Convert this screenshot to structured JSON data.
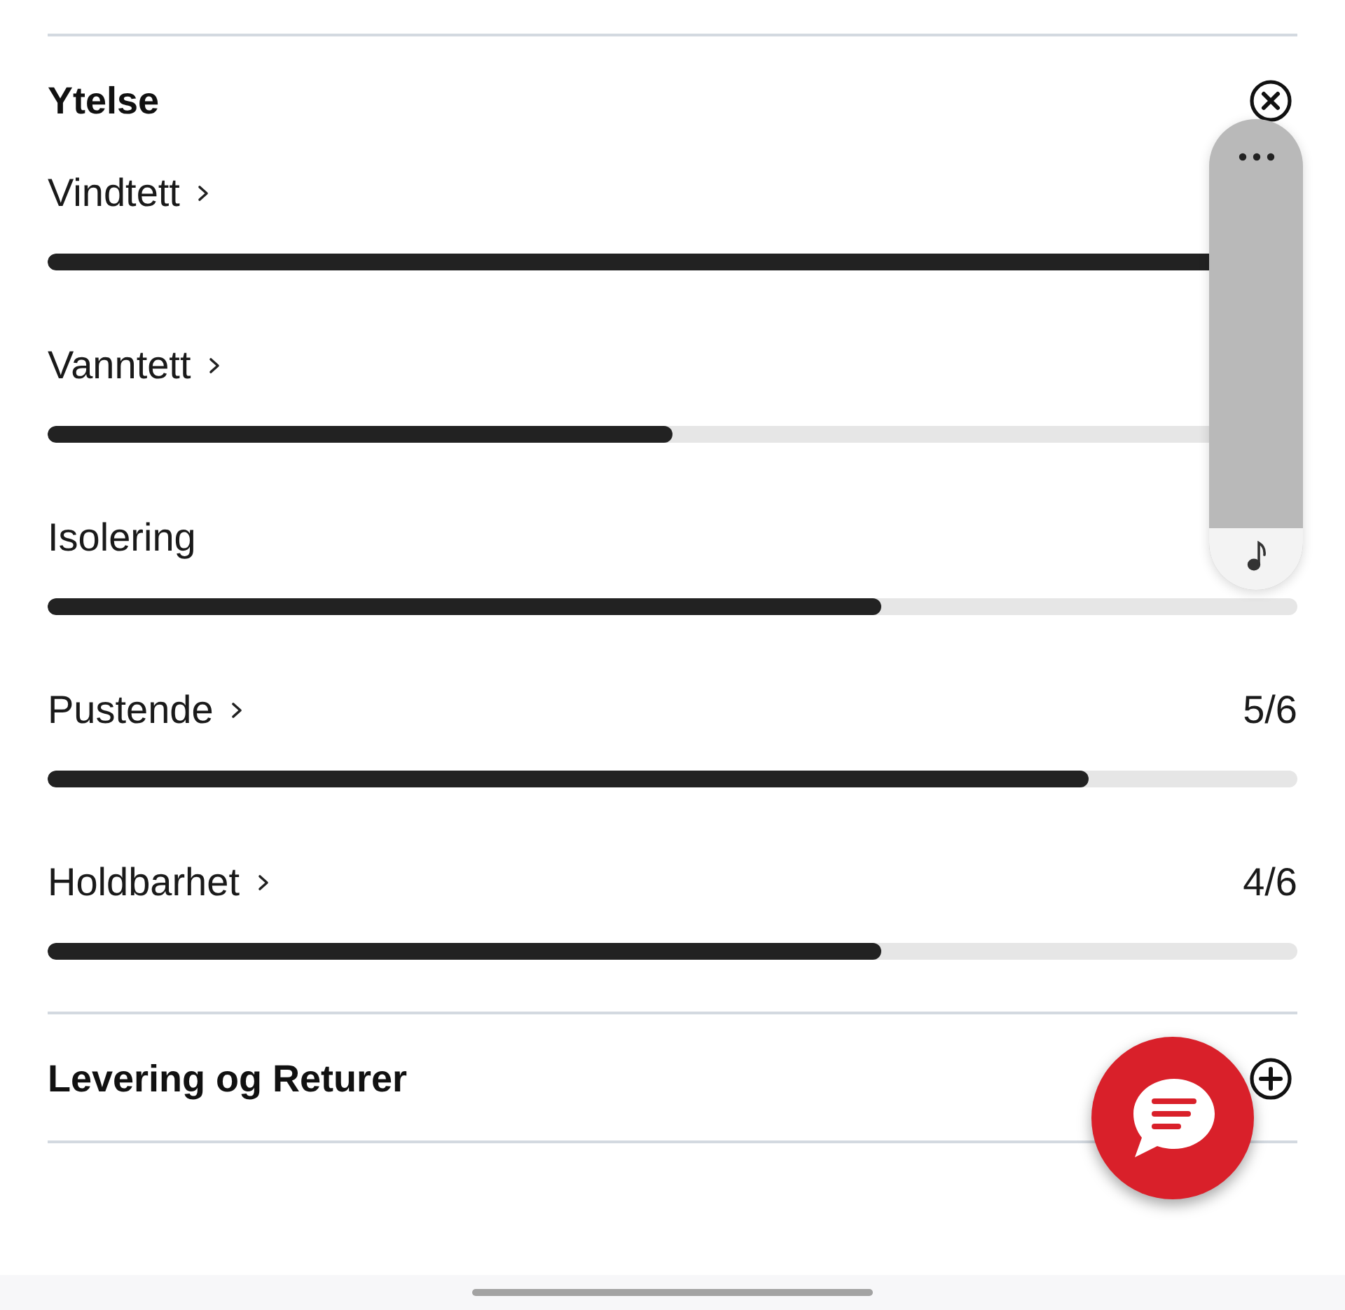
{
  "sections": [
    {
      "title": "Ytelse",
      "expanded": true,
      "attributes": [
        {
          "label": "Vindtett",
          "link": true,
          "level": 1
        },
        {
          "label": "Vanntett",
          "link": true,
          "level": 0.5
        },
        {
          "label": "Isolering",
          "link": false,
          "level": 0.6667
        },
        {
          "label": "Pustende",
          "link": true,
          "rating": "5/6",
          "level": 0.8333
        },
        {
          "label": "Holdbarhet",
          "link": true,
          "rating": "4/6",
          "level": 0.6667
        }
      ]
    },
    {
      "title": "Levering og Returer",
      "expanded": false
    }
  ]
}
